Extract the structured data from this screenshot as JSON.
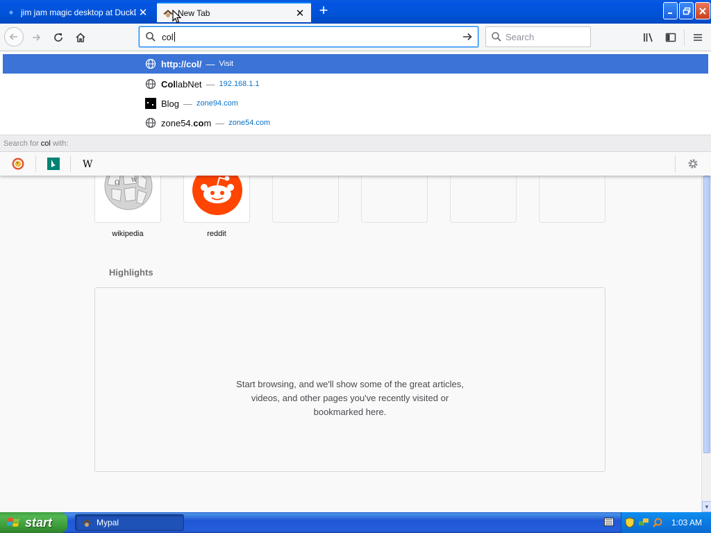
{
  "tabs": [
    {
      "title": "jim jam magic desktop at DuckDuc"
    },
    {
      "title": "New Tab"
    }
  ],
  "urlbar": {
    "value": "col"
  },
  "searchbar": {
    "placeholder": "Search"
  },
  "autocomplete": [
    {
      "title": "http://col/",
      "sep": "—",
      "action": "Visit"
    },
    {
      "title_bold": "Col",
      "title_rest": "labNet",
      "sep": "—",
      "url": "192.168.1.1"
    },
    {
      "title": "Blog",
      "sep": "—",
      "url": "zone94.com"
    },
    {
      "title_plain": "zone54.",
      "title_bold": "co",
      "title_rest": "m",
      "sep": "—",
      "url": "zone54.com"
    }
  ],
  "search_with": {
    "prefix": "Search for",
    "query": "col",
    "suffix": "with:"
  },
  "engines": [
    "duckduckgo-icon",
    "bing-icon",
    "wikipedia-icon"
  ],
  "top_sites": [
    {
      "label": "wikipedia"
    },
    {
      "label": "reddit"
    }
  ],
  "highlights": {
    "title": "Highlights",
    "empty_line1": "Start browsing, and we'll show some of the great articles,",
    "empty_line2": "videos, and other pages you've recently visited or",
    "empty_line3": "bookmarked here."
  },
  "taskbar": {
    "start": "start",
    "window": "Mypal",
    "clock": "1:03 AM"
  },
  "colors": {
    "selected_row": "#3b73d6",
    "url_text": "#0a71c7",
    "xp_blue": "#0053d8",
    "reddit": "#ff4500"
  }
}
